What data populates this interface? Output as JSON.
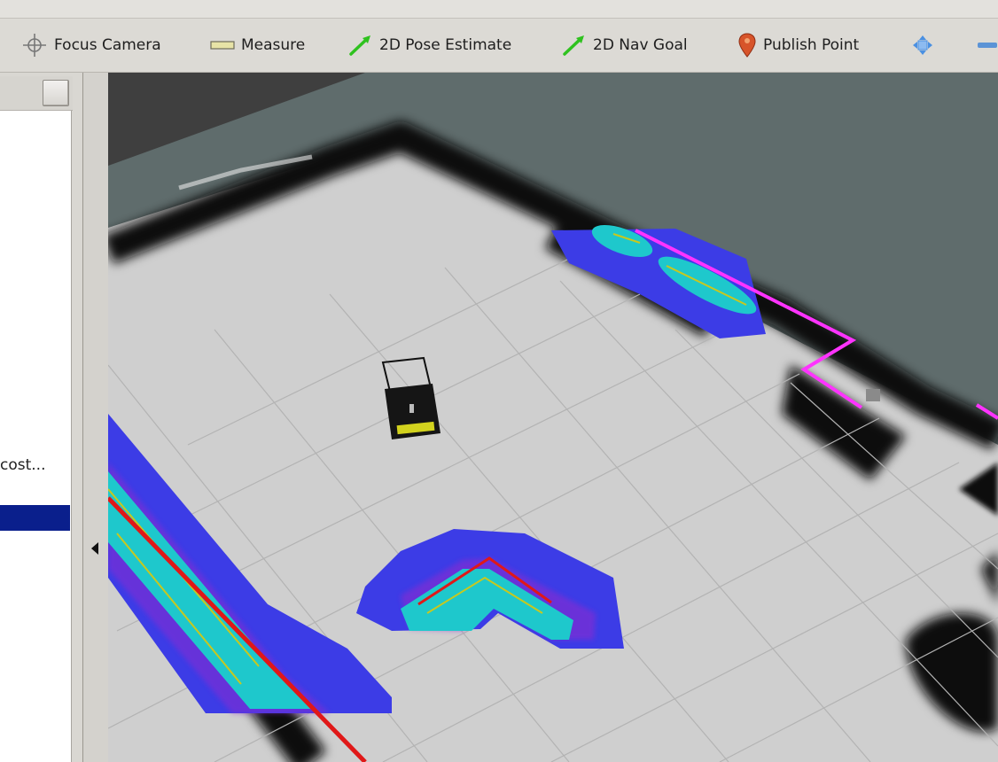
{
  "toolbar": {
    "tools": [
      {
        "label": "Focus Camera",
        "icon": "crosshair-icon"
      },
      {
        "label": "Measure",
        "icon": "ruler-icon"
      },
      {
        "label": "2D Pose Estimate",
        "icon": "green-arrow-icon"
      },
      {
        "label": "2D Nav Goal",
        "icon": "green-arrow-icon"
      },
      {
        "label": "Publish Point",
        "icon": "map-pin-icon"
      },
      {
        "label": "",
        "icon": "move-camera-icon"
      },
      {
        "label": "",
        "icon": "minus-icon"
      }
    ]
  },
  "displays_panel": {
    "truncated_item": "cost..."
  },
  "colors": {
    "grid_floor": "#cfcfcf",
    "obstacle": "#0d0d0d",
    "inflation_blue": "#3c3ce6",
    "inflation_cyan": "#1ec8cc",
    "laser_red": "#e01818",
    "plan_magenta": "#ff33ff",
    "selection": "#0a1f8c",
    "background": "#5f6c6c"
  }
}
